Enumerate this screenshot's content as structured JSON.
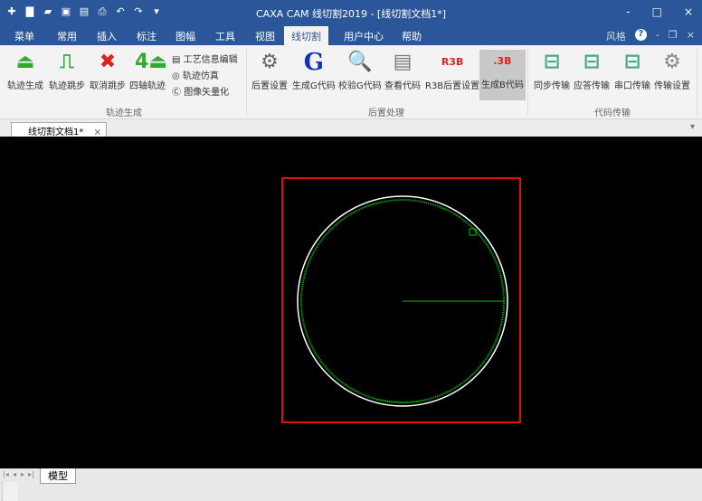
{
  "titlebar": {
    "title": "CAXA CAM 线切割2019 - [线切割文档1*]",
    "minimize": "-",
    "maximize": "□",
    "close": "×"
  },
  "tabs": [
    "菜单",
    "常用",
    "插入",
    "标注",
    "图幅",
    "工具",
    "视图",
    "线切割",
    "用户中心",
    "帮助"
  ],
  "tabright": {
    "style": "风格",
    "help": "?"
  },
  "ribbon": {
    "traj": [
      {
        "label": "轨迹生成"
      },
      {
        "label": "轨迹跳步"
      },
      {
        "label": "取消跳步"
      },
      {
        "label": "四轴轨迹"
      }
    ],
    "traj_small": [
      "工艺信息编辑",
      "轨迹仿真",
      "图像矢量化"
    ],
    "traj_group": "轨迹生成",
    "post": [
      {
        "label": "后置设置"
      },
      {
        "label": "生成G代码"
      },
      {
        "label": "校验G代码"
      },
      {
        "label": "查看代码"
      },
      {
        "label": "R3B后置设置"
      },
      {
        "label": "生成B代码"
      }
    ],
    "post_group": "后置处理",
    "transfer": [
      {
        "label": "同步传输"
      },
      {
        "label": "应答传输"
      },
      {
        "label": "串口传输"
      },
      {
        "label": "传输设置"
      }
    ],
    "transfer_group": "代码传输"
  },
  "document": {
    "tab": "线切割文档1*",
    "close": "×"
  },
  "bottom": {
    "model_tab": "模型"
  },
  "colors": {
    "accent": "#2b579a",
    "frame": "#e01010",
    "circle": "#ffffff",
    "path": "#00c000"
  }
}
